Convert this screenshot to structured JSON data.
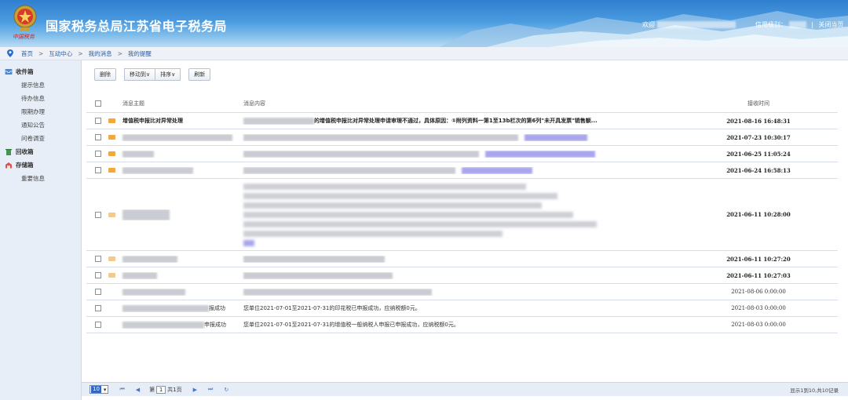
{
  "header": {
    "title": "国家税务总局江苏省电子税务局",
    "logo_script": "中国税务",
    "welcome": "欢迎",
    "credit_label": "信用级别：",
    "close_label": "关闭当页",
    "separator": "|"
  },
  "breadcrumb": [
    "首页",
    "互动中心",
    "我的消息",
    "我的提醒"
  ],
  "sidebar": {
    "inbox": "收件箱",
    "inbox_items": [
      "提示信息",
      "待办信息",
      "限期办理",
      "通知公告",
      "问卷调查"
    ],
    "recycle": "回收箱",
    "saved": "存储箱",
    "saved_items": [
      "重要信息"
    ]
  },
  "toolbar": {
    "delete": "删除",
    "move_to": "移动到∨",
    "sort": "排序∨",
    "refresh": "刷新"
  },
  "table": {
    "headers": {
      "subject": "消息主题",
      "content": "消息内容",
      "time": "接收时间"
    },
    "rows": [
      {
        "subject": "增值税申报比对异常处理",
        "content": "的增值税申报比对异常处理申请审理不通过，具体原因：①附列资料一第1至13b栏次的第6列\"未开具发票\"销售额...",
        "time": "2021-08-16 16:48:31",
        "unread": true
      },
      {
        "subject": "",
        "content": "",
        "time": "2021-07-23 10:30:17",
        "unread": true
      },
      {
        "subject": "",
        "content": "",
        "time": "2021-06-25 11:05:24",
        "unread": true
      },
      {
        "subject": "",
        "content": "",
        "time": "2021-06-24 16:58:13",
        "unread": true
      },
      {
        "subject": "",
        "content": "",
        "time": "2021-06-11 10:28:00",
        "unread": true
      },
      {
        "subject": "",
        "content": "",
        "time": "2021-06-11 10:27:20",
        "unread": true
      },
      {
        "subject": "",
        "content": "",
        "time": "2021-06-11 10:27:03",
        "unread": true
      },
      {
        "subject": "",
        "content": "",
        "time": "2021-08-06 0:00:00",
        "unread": false
      },
      {
        "subject": "报成功",
        "content": "您单位2021-07-01至2021-07-31的印花税已申报成功，应纳税额0元。",
        "time": "2021-08-03 0:00:00",
        "unread": false
      },
      {
        "subject": "申报成功",
        "content": "您单位2021-07-01至2021-07-31的增值税一般纳税人申报已申报成功，应纳税额0元。",
        "time": "2021-08-03 0:00:00",
        "unread": false
      }
    ]
  },
  "pager": {
    "page_size": "10",
    "page_label_pre": "第",
    "page_value": "1",
    "page_label_post": "共1页",
    "info": "显示1到10,共10记录"
  },
  "colors": {
    "header_top": "#2f7fd0",
    "link_blue": "#2a5ea8",
    "sidebar_bg": "#e8eef7",
    "envelope": "#f2a83c"
  }
}
